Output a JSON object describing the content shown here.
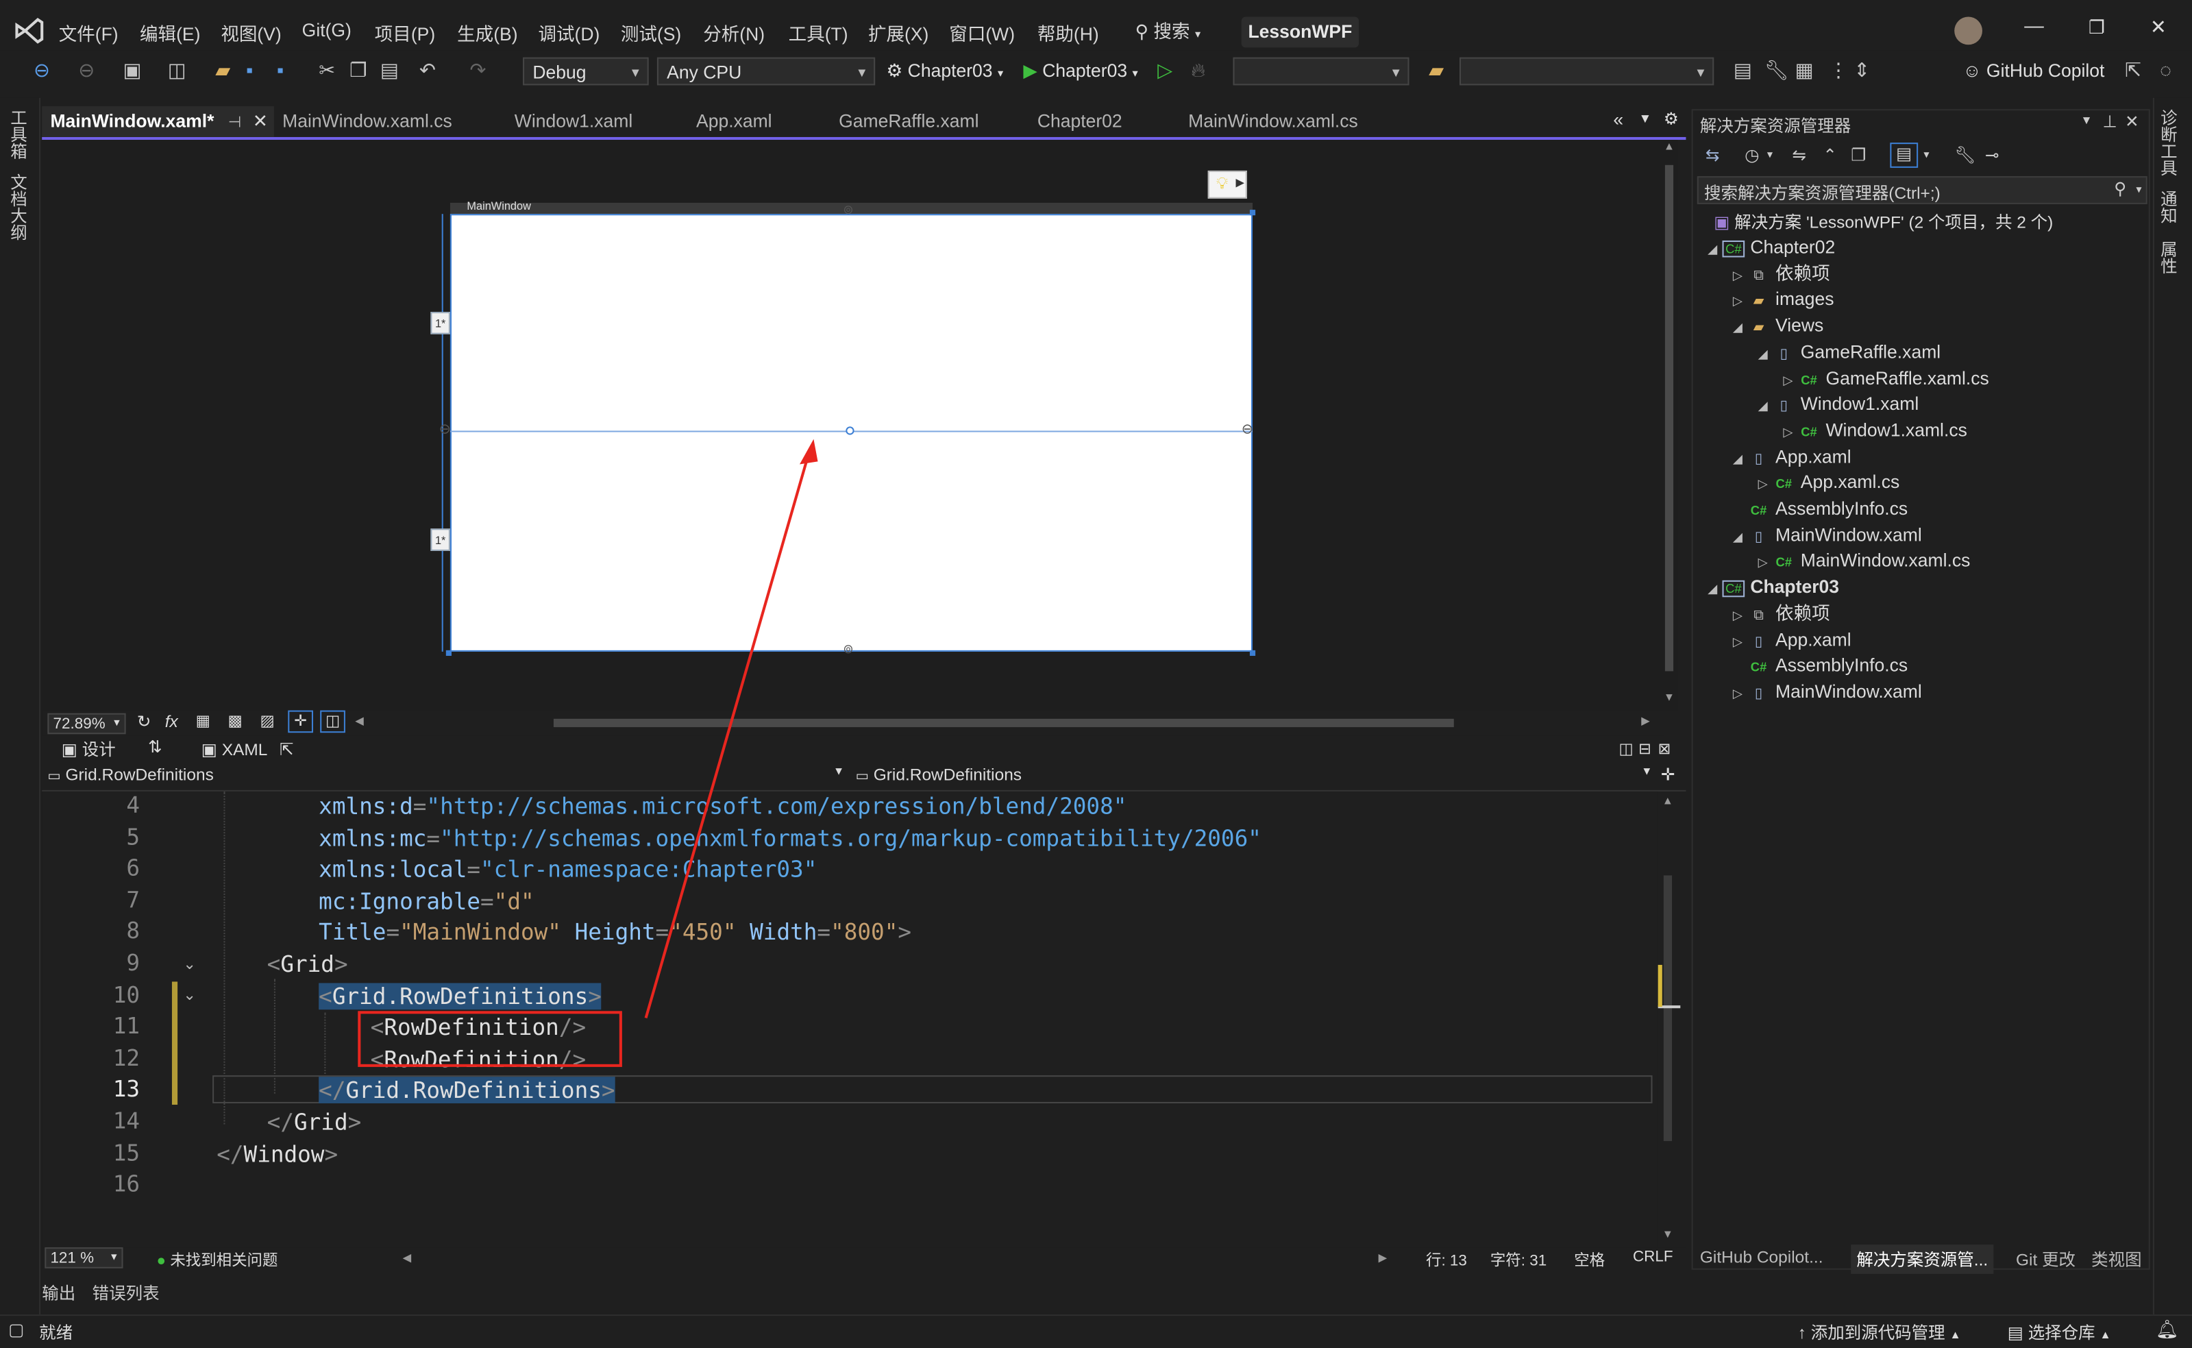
{
  "menubar": {
    "items": [
      "文件(F)",
      "编辑(E)",
      "视图(V)",
      "Git(G)",
      "项目(P)",
      "生成(B)",
      "调试(D)",
      "测试(S)",
      "分析(N)",
      "工具(T)",
      "扩展(X)",
      "窗口(W)",
      "帮助(H)"
    ],
    "search_label": "搜索",
    "solution_name": "LessonWPF"
  },
  "toolbar": {
    "config": "Debug",
    "platform": "Any CPU",
    "startup_project": "Chapter03",
    "run_target": "Chapter03",
    "copilot": "GitHub Copilot"
  },
  "tabs": [
    "MainWindow.xaml*",
    "MainWindow.xaml.cs",
    "Window1.xaml",
    "App.xaml",
    "GameRaffle.xaml",
    "Chapter02",
    "MainWindow.xaml.cs"
  ],
  "left_rail": [
    "工具箱",
    "文档大纲"
  ],
  "right_rail": [
    "诊断工具",
    "通知",
    "属性"
  ],
  "designer": {
    "window_title": "MainWindow",
    "row_marker_1": "1*",
    "row_marker_2": "1*",
    "zoom": "72.89%",
    "fx_label": "fx"
  },
  "split_tabs": {
    "design": "设计",
    "swap": "⇅",
    "xaml": "XAML"
  },
  "nav": {
    "left": "Grid.RowDefinitions",
    "right": "Grid.RowDefinitions"
  },
  "code": {
    "lines": [
      {
        "n": "4",
        "text": "xmlns:d=\"http://schemas.microsoft.com/expression/blend/2008\""
      },
      {
        "n": "5",
        "text": "xmlns:mc=\"http://schemas.openxmlformats.org/markup-compatibility/2006\""
      },
      {
        "n": "6",
        "text": "xmlns:local=\"clr-namespace:Chapter03\""
      },
      {
        "n": "7",
        "text": "mc:Ignorable=\"d\""
      },
      {
        "n": "8",
        "text": "Title=\"MainWindow\" Height=\"450\" Width=\"800\">"
      },
      {
        "n": "9",
        "text": "<Grid>"
      },
      {
        "n": "10",
        "text": "<Grid.RowDefinitions>"
      },
      {
        "n": "11",
        "text": "<RowDefinition/>"
      },
      {
        "n": "12",
        "text": "<RowDefinition/>"
      },
      {
        "n": "13",
        "text": "</Grid.RowDefinitions>"
      },
      {
        "n": "14",
        "text": "</Grid>"
      },
      {
        "n": "15",
        "text": "</Window>"
      },
      {
        "n": "16",
        "text": ""
      }
    ]
  },
  "editor_status": {
    "zoom": "121 %",
    "issues": "未找到相关问题",
    "line": "行: 13",
    "char": "字符: 31",
    "spaces": "空格",
    "eol": "CRLF"
  },
  "bottom_tabs": [
    "输出",
    "错误列表"
  ],
  "statusbar": {
    "ready": "就绪",
    "add_source": "添加到源代码管理",
    "select_repo": "选择仓库"
  },
  "solution_explorer": {
    "title": "解决方案资源管理器",
    "search_placeholder": "搜索解决方案资源管理器(Ctrl+;)",
    "solution": "解决方案 'LessonWPF' (2 个项目，共 2 个)",
    "tree": [
      {
        "label": "Chapter02",
        "icon": "csproj-icon",
        "depth": 0,
        "arrow": "down"
      },
      {
        "label": "依赖项",
        "icon": "dependencies-icon",
        "depth": 1,
        "arrow": "right"
      },
      {
        "label": "images",
        "icon": "folder-icon",
        "depth": 1,
        "arrow": "right"
      },
      {
        "label": "Views",
        "icon": "folder-icon",
        "depth": 1,
        "arrow": "down"
      },
      {
        "label": "GameRaffle.xaml",
        "icon": "xaml-file-icon",
        "depth": 2,
        "arrow": "down"
      },
      {
        "label": "GameRaffle.xaml.cs",
        "icon": "cs-file-icon",
        "depth": 3,
        "arrow": "right"
      },
      {
        "label": "Window1.xaml",
        "icon": "xaml-file-icon",
        "depth": 2,
        "arrow": "down"
      },
      {
        "label": "Window1.xaml.cs",
        "icon": "cs-file-icon",
        "depth": 3,
        "arrow": "right"
      },
      {
        "label": "App.xaml",
        "icon": "xaml-file-icon",
        "depth": 1,
        "arrow": "down"
      },
      {
        "label": "App.xaml.cs",
        "icon": "cs-file-icon",
        "depth": 2,
        "arrow": "right"
      },
      {
        "label": "AssemblyInfo.cs",
        "icon": "cs-file-icon",
        "depth": 1,
        "arrow": ""
      },
      {
        "label": "MainWindow.xaml",
        "icon": "xaml-file-icon",
        "depth": 1,
        "arrow": "down"
      },
      {
        "label": "MainWindow.xaml.cs",
        "icon": "cs-file-icon",
        "depth": 2,
        "arrow": "right"
      },
      {
        "label": "Chapter03",
        "icon": "csproj-icon",
        "depth": 0,
        "arrow": "down",
        "bold": true
      },
      {
        "label": "依赖项",
        "icon": "dependencies-icon",
        "depth": 1,
        "arrow": "right"
      },
      {
        "label": "App.xaml",
        "icon": "xaml-file-icon",
        "depth": 1,
        "arrow": "right"
      },
      {
        "label": "AssemblyInfo.cs",
        "icon": "cs-file-icon",
        "depth": 1,
        "arrow": ""
      },
      {
        "label": "MainWindow.xaml",
        "icon": "xaml-file-icon",
        "depth": 1,
        "arrow": "right"
      }
    ],
    "bottom_tabs": [
      "GitHub Copilot...",
      "解决方案资源管...",
      "Git 更改",
      "类视图"
    ]
  },
  "colors": {
    "accent": "#7160e8",
    "selection": "#264f78",
    "annotation": "#e8261f",
    "bg": "#1f1f1f"
  }
}
